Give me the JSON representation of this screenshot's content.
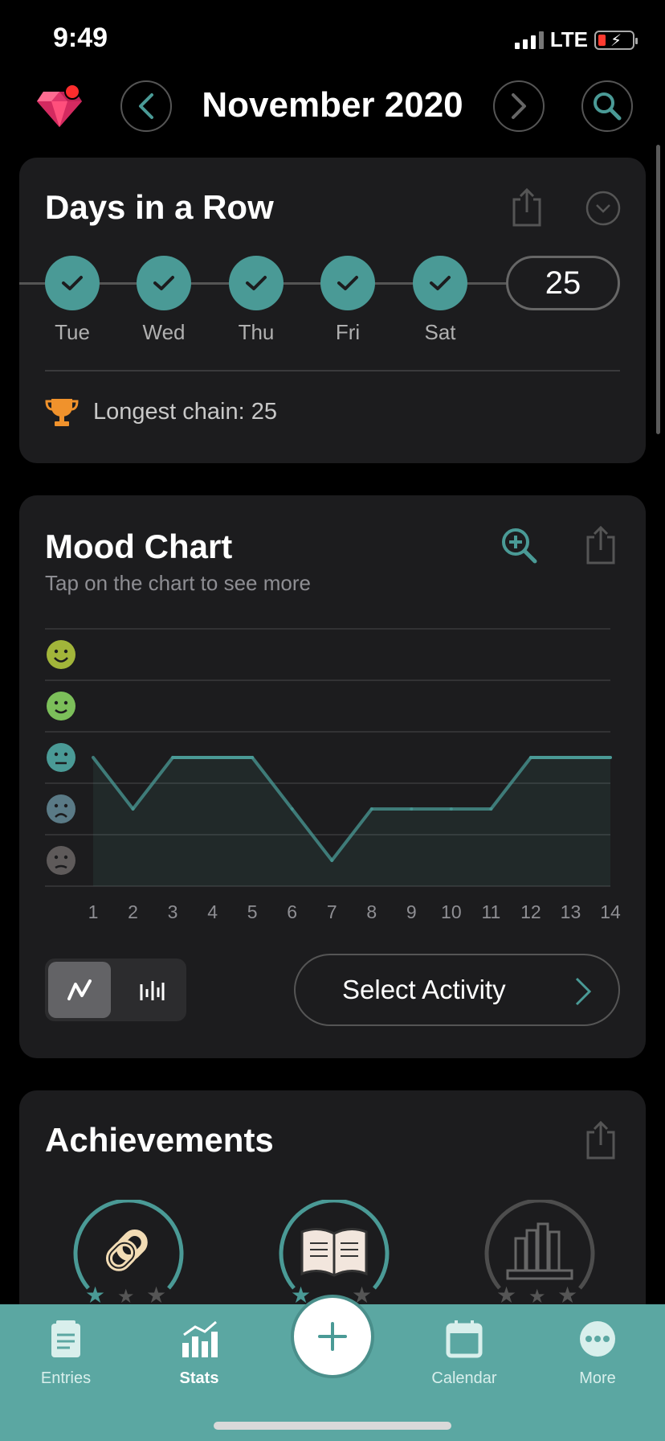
{
  "status": {
    "time": "9:49",
    "network": "LTE"
  },
  "header": {
    "month": "November 2020"
  },
  "streak": {
    "title": "Days in a Row",
    "days": [
      {
        "label": "Tue",
        "done": true
      },
      {
        "label": "Wed",
        "done": true
      },
      {
        "label": "Thu",
        "done": true
      },
      {
        "label": "Fri",
        "done": true
      },
      {
        "label": "Sat",
        "done": true
      }
    ],
    "count": "25",
    "longest_chain": "Longest chain: 25"
  },
  "mood": {
    "title": "Mood Chart",
    "subtitle": "Tap on the chart to see more",
    "select_activity": "Select Activity",
    "colors": {
      "line": "#4a9a96",
      "rad": "#a2b53a",
      "good": "#7cbf5a",
      "meh": "#4a9a96",
      "bad": "#5a7a86",
      "awful": "#5e5a5a"
    }
  },
  "chart_data": {
    "type": "line",
    "x": [
      1,
      2,
      3,
      4,
      5,
      6,
      7,
      8,
      9,
      10,
      11,
      12,
      13,
      14
    ],
    "tick_labels": [
      "1",
      "2",
      "3",
      "4",
      "5",
      "6",
      "7",
      "8",
      "9",
      "10",
      "11",
      "12",
      "13",
      "14"
    ],
    "y_levels": [
      "awful",
      "bad",
      "meh",
      "good",
      "rad"
    ],
    "values": [
      3,
      2,
      3,
      3,
      3,
      2,
      1,
      2,
      2,
      2,
      2,
      3,
      3,
      3
    ],
    "ylim": [
      1,
      5
    ],
    "grid": true
  },
  "achievements": {
    "title": "Achievements"
  },
  "tabbar": {
    "entries": "Entries",
    "stats": "Stats",
    "calendar": "Calendar",
    "more": "More"
  }
}
